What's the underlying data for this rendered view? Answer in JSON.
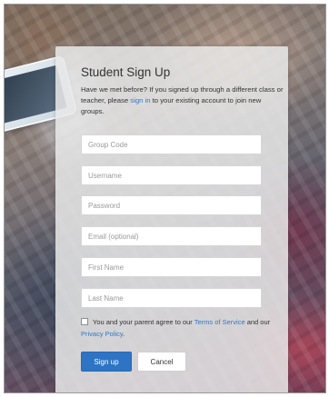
{
  "page": {
    "title": "Student Sign Up",
    "intro_prefix": "Have we met before? If you signed up through a different class or teacher, please ",
    "intro_link": "sign in",
    "intro_suffix": " to your existing account to join new groups."
  },
  "form": {
    "fields": [
      {
        "placeholder": "Group Code",
        "value": ""
      },
      {
        "placeholder": "Username",
        "value": ""
      },
      {
        "placeholder": "Password",
        "value": ""
      },
      {
        "placeholder": "Email (optional)",
        "value": ""
      },
      {
        "placeholder": "First Name",
        "value": ""
      },
      {
        "placeholder": "Last Name",
        "value": ""
      }
    ],
    "terms_prefix": "You and your parent agree to our ",
    "terms_link": "Terms of Service",
    "terms_middle": " and our ",
    "privacy_link": "Privacy Policy",
    "terms_suffix": ".",
    "terms_checked": false
  },
  "buttons": {
    "signup_label": "Sign up",
    "cancel_label": "Cancel"
  },
  "colors": {
    "accent": "#2e74c5",
    "link": "#2e79c7"
  }
}
